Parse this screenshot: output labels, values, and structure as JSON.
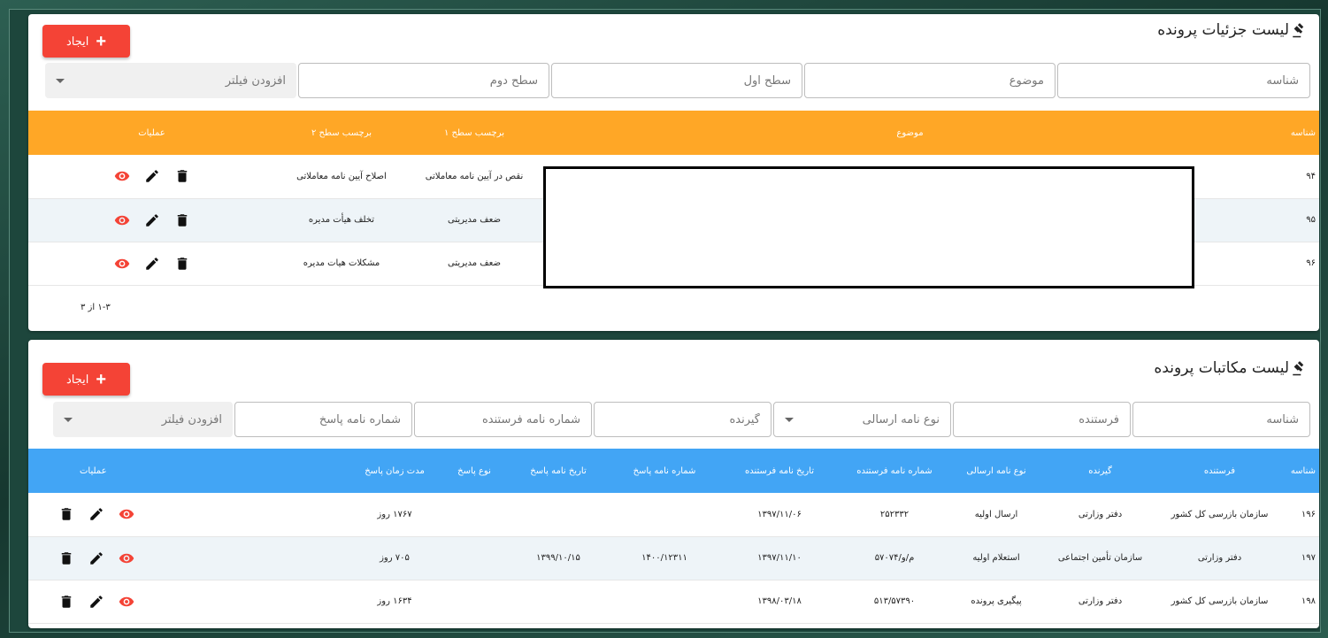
{
  "details": {
    "title": "لیست جزئیات پرونده",
    "create_label": "ایجاد",
    "filters": {
      "id_placeholder": "شناسه",
      "subject_placeholder": "موضوع",
      "level1_placeholder": "سطح اول",
      "level2_placeholder": "سطح دوم",
      "add_filter": "افزودن فیلتر"
    },
    "columns": [
      "شناسه",
      "موضوع",
      "برچسب سطح ۱",
      "برچسب سطح ۲",
      "عملیات"
    ],
    "rows": [
      {
        "id": "۹۴",
        "level1": "نقص در آیین نامه معاملاتی",
        "level2": "اصلاح آیین نامه معاملاتی"
      },
      {
        "id": "۹۵",
        "level1": "ضعف مدیریتی",
        "level2": "تخلف هیأت مدیره"
      },
      {
        "id": "۹۶",
        "level1": "ضعف مدیریتی",
        "level2": "مشکلات هیات مدیره"
      }
    ],
    "pagination": "۱-۳ از ۳"
  },
  "letters": {
    "title": "لیست مکاتبات پرونده",
    "create_label": "ایجاد",
    "filters": {
      "id_placeholder": "شناسه",
      "sender_placeholder": "فرستنده",
      "letter_type_placeholder": "نوع نامه ارسالی",
      "receiver_placeholder": "گیرنده",
      "sender_letter_no_placeholder": "شماره نامه فرستنده",
      "reply_letter_no_placeholder": "شماره نامه پاسخ",
      "add_filter": "افزودن فیلتر"
    },
    "columns": [
      "شناسه",
      "فرستنده",
      "گیرنده",
      "نوع نامه ارسالی",
      "شماره نامه فرستنده",
      "تاریخ نامه فرستنده",
      "شماره نامه پاسخ",
      "تاریخ نامه پاسخ",
      "نوع پاسخ",
      "مدت زمان پاسخ",
      "عملیات"
    ],
    "rows": [
      {
        "id": "۱۹۶",
        "sender": "سازمان بازرسی کل کشور",
        "receiver": "دفتر وزارتی",
        "type": "ارسال اولیه",
        "sender_no": "۲۵۲۳۳۲",
        "sender_date": "۱۳۹۷/۱۱/۰۶",
        "reply_no": "",
        "reply_date": "",
        "reply_type": "",
        "duration": "۱۷۶۷ روز"
      },
      {
        "id": "۱۹۷",
        "sender": "دفتر وزارتی",
        "receiver": "سازمان تأمین اجتماعی",
        "type": "استعلام اولیه",
        "sender_no": "م/و/۵۷۰۷۴",
        "sender_date": "۱۳۹۷/۱۱/۱۰",
        "reply_no": "۱۴۰۰/۱۲۳۱۱",
        "reply_date": "۱۳۹۹/۱۰/۱۵",
        "reply_type": "",
        "duration": "۷۰۵ روز"
      },
      {
        "id": "۱۹۸",
        "sender": "سازمان بازرسی کل کشور",
        "receiver": "دفتر وزارتی",
        "type": "پیگیری پرونده",
        "sender_no": "۵۱۳/۵۷۳۹۰",
        "sender_date": "۱۳۹۸/۰۳/۱۸",
        "reply_no": "",
        "reply_date": "",
        "reply_type": "",
        "duration": "۱۶۳۴ روز"
      }
    ]
  },
  "colors": {
    "create_button": "#f44336",
    "details_header": "#ffa726",
    "letters_header": "#42a5f5",
    "view_icon": "#f44336"
  },
  "icons": {
    "title": "gavel-icon",
    "create": "plus-icon",
    "view": "eye-icon",
    "edit": "pencil-icon",
    "delete": "trash-icon",
    "dropdown": "caret-down-icon"
  }
}
